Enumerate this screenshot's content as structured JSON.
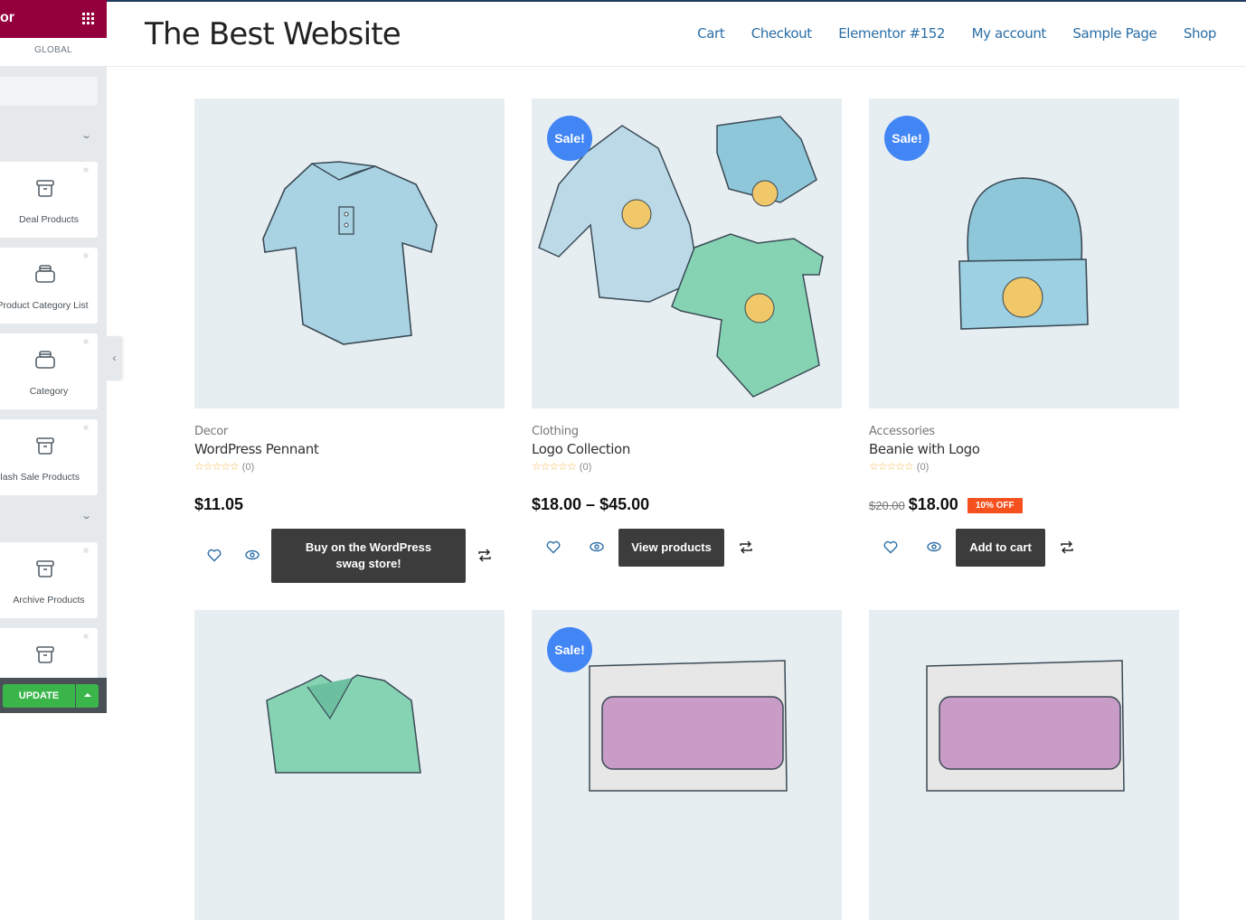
{
  "editor": {
    "logo_fragment": "or",
    "tab": "GLOBAL",
    "widgets": [
      {
        "label": "Deal Products",
        "icon": "archive-icon"
      },
      {
        "label": "Product Category List",
        "icon": "category-icon"
      },
      {
        "label": "Category",
        "icon": "category-icon"
      },
      {
        "label": "Flash Sale Products",
        "icon": "archive-icon"
      },
      {
        "label": "Archive Products",
        "icon": "archive-icon"
      },
      {
        "label": "",
        "icon": "archive-icon"
      }
    ],
    "update_label": "UPDATE"
  },
  "site": {
    "title": "The Best Website",
    "nav": [
      "Cart",
      "Checkout",
      "Elementor #152",
      "My account",
      "Sample Page",
      "Shop"
    ]
  },
  "products": [
    {
      "category": "Decor",
      "title": "WordPress Pennant",
      "rating_count": "(0)",
      "stars": "☆☆☆☆☆",
      "price": "$11.05",
      "button": "Buy on the WordPress swag store!",
      "sale": false
    },
    {
      "category": "Clothing",
      "title": "Logo Collection",
      "rating_count": "(0)",
      "stars": "☆☆☆☆☆",
      "price": "$18.00 – $45.00",
      "button": "View products",
      "sale": true,
      "sale_label": "Sale!"
    },
    {
      "category": "Accessories",
      "title": "Beanie with Logo",
      "rating_count": "(0)",
      "stars": "☆☆☆☆☆",
      "old_price": "$20.00",
      "price": "$18.00",
      "discount": "10% OFF",
      "button": "Add to cart",
      "sale": true,
      "sale_label": "Sale!"
    }
  ],
  "second_row": [
    {
      "sale": false
    },
    {
      "sale": true,
      "sale_label": "Sale!"
    },
    {
      "sale": false
    }
  ],
  "colors": {
    "editor_brand": "#93003c",
    "link": "#2b6ea6",
    "sale_badge": "#4285f4",
    "discount_badge": "#f5511e",
    "button_dark": "#3c3c3c",
    "update_green": "#39b54a"
  }
}
